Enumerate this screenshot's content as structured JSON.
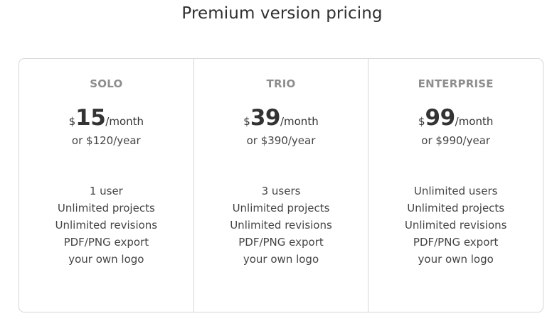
{
  "title": "Premium version pricing",
  "plans": [
    {
      "name": "SOLO",
      "currency": "$",
      "price": "15",
      "period": "/month",
      "yearly": "or $120/year",
      "features": [
        "1 user",
        "Unlimited projects",
        "Unlimited revisions",
        "PDF/PNG export",
        "your own logo"
      ]
    },
    {
      "name": "TRIO",
      "currency": "$",
      "price": "39",
      "period": "/month",
      "yearly": "or $390/year",
      "features": [
        "3 users",
        "Unlimited projects",
        "Unlimited revisions",
        "PDF/PNG export",
        "your own logo"
      ]
    },
    {
      "name": "ENTERPRISE",
      "currency": "$",
      "price": "99",
      "period": "/month",
      "yearly": "or $990/year",
      "features": [
        "Unlimited users",
        "Unlimited projects",
        "Unlimited revisions",
        "PDF/PNG export",
        "your own logo"
      ]
    }
  ],
  "colors": {
    "border": "#d6d6d6",
    "plan_name": "#8e8e8e",
    "text": "#333333"
  }
}
